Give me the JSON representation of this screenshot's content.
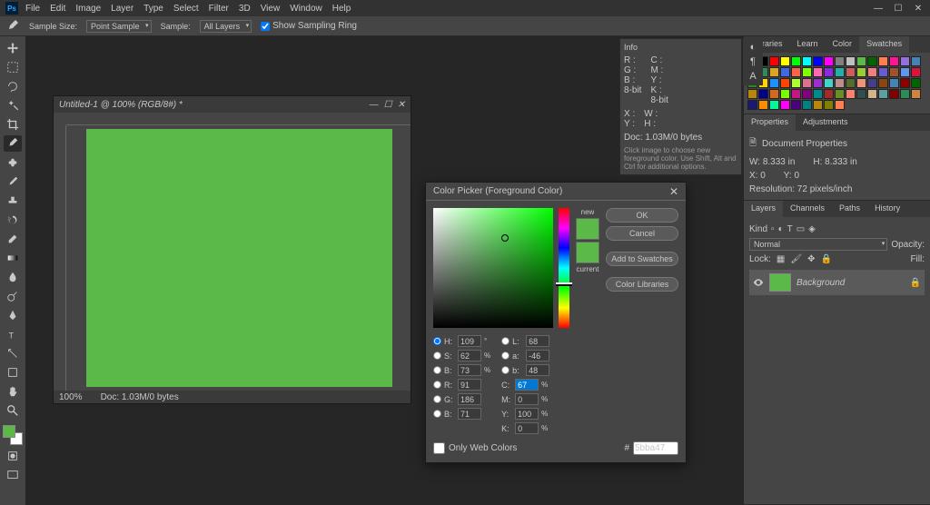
{
  "menu": [
    "File",
    "Edit",
    "Image",
    "Layer",
    "Type",
    "Select",
    "Filter",
    "3D",
    "View",
    "Window",
    "Help"
  ],
  "options": {
    "sampleSizeLabel": "Sample Size:",
    "sampleSizeValue": "Point Sample",
    "sampleLabel": "Sample:",
    "sampleValue": "All Layers",
    "showRing": "Show Sampling Ring"
  },
  "document": {
    "title": "Untitled-1 @ 100% (RGB/8#) *",
    "zoom": "100%",
    "statusDoc": "Doc: 1.03M/0 bytes"
  },
  "info": {
    "title": "Info",
    "docline": "Doc: 1.03M/0 bytes",
    "hint": "Click image to choose new foreground color. Use Shift, Alt and Ctrl for additional options."
  },
  "swatchPanel": {
    "tabs": [
      "Libraries",
      "Learn",
      "Color",
      "Swatches"
    ],
    "colors": [
      "#ffffff",
      "#000000",
      "#ff0000",
      "#ffff00",
      "#00ff00",
      "#00ffff",
      "#0000ff",
      "#ff00ff",
      "#808080",
      "#c0c0c0",
      "#5bba47",
      "#006400",
      "#ff7f50",
      "#ff1493",
      "#9370db",
      "#4682b4",
      "#b22222",
      "#2e8b57",
      "#daa520",
      "#4169e1",
      "#ff6347",
      "#7fff00",
      "#ff69b4",
      "#8a2be2",
      "#20b2aa",
      "#cd5c5c",
      "#9acd32",
      "#f08080",
      "#6a5acd",
      "#a0522d",
      "#6495ed",
      "#dc143c",
      "#228b22",
      "#ffd700",
      "#1e90ff",
      "#ff4500",
      "#adff2f",
      "#db7093",
      "#9932cc",
      "#48d1cc",
      "#bc8f8f",
      "#556b2f",
      "#e9967a",
      "#483d8b",
      "#8b4513",
      "#4682b4",
      "#8b0000",
      "#006400",
      "#b8860b",
      "#00008b",
      "#d2691e",
      "#7cfc00",
      "#c71585",
      "#800080",
      "#008b8b",
      "#a52a2a",
      "#6b8e23",
      "#fa8072",
      "#2f4f4f",
      "#d2b48c",
      "#5f9ea0",
      "#800000",
      "#2e8b57",
      "#cd853f",
      "#191970",
      "#ff8c00",
      "#00fa9a",
      "#ff00ff",
      "#4b0082",
      "#008080",
      "#b8860b",
      "#808000",
      "#ff7f50"
    ]
  },
  "properties": {
    "tabs": [
      "Properties",
      "Adjustments"
    ],
    "title": "Document Properties",
    "w": "W: 8.333 in",
    "h": "H: 8.333 in",
    "x": "X: 0",
    "y": "Y: 0",
    "res": "Resolution: 72 pixels/inch"
  },
  "layers": {
    "tabs": [
      "Layers",
      "Channels",
      "Paths",
      "History"
    ],
    "kind": "Kind",
    "blend": "Normal",
    "opacityLabel": "Opacity:",
    "lockLabel": "Lock:",
    "fillLabel": "Fill:",
    "bgName": "Background"
  },
  "colorPicker": {
    "title": "Color Picker (Foreground Color)",
    "new": "new",
    "current": "current",
    "ok": "OK",
    "cancel": "Cancel",
    "addSwatches": "Add to Swatches",
    "colorLibs": "Color Libraries",
    "webOnly": "Only Web Colors",
    "H": "109",
    "S": "62",
    "Bval": "73",
    "R": "91",
    "G": "186",
    "Bblue": "71",
    "L": "68",
    "a": "-46",
    "bLab": "48",
    "C": "67",
    "M": "0",
    "Y": "100",
    "K": "0",
    "hex": "5bba47",
    "newColor": "#5bba47",
    "curColor": "#5bba47"
  }
}
